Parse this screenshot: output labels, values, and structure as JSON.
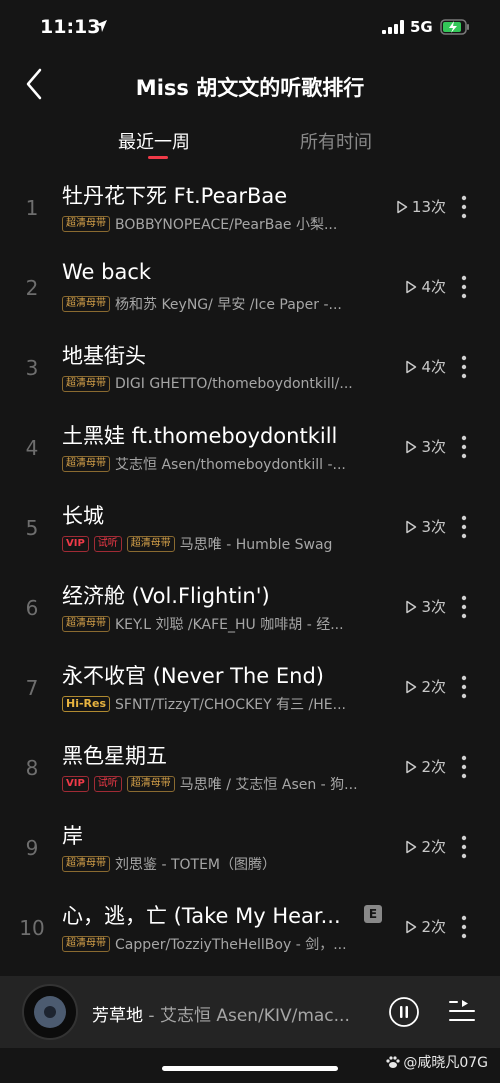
{
  "status": {
    "time": "11:13",
    "network": "5G"
  },
  "header": {
    "title": "Miss 胡文文的听歌排行"
  },
  "tabs": [
    {
      "label": "最近一周",
      "active": true
    },
    {
      "label": "所有时间",
      "active": false
    }
  ],
  "songs": [
    {
      "rank": "1",
      "title": "牡丹花下死 Ft.PearBae",
      "tags": [
        "超清母带"
      ],
      "artist": "BOBBYNOPEACE/PearBae 小梨...",
      "plays": "13次"
    },
    {
      "rank": "2",
      "title": "We back",
      "tags": [
        "超清母带"
      ],
      "artist": "杨和苏 KeyNG/ 早安 /Ice Paper -...",
      "plays": "4次"
    },
    {
      "rank": "3",
      "title": "地基街头",
      "tags": [
        "超清母带"
      ],
      "artist": "DIGI GHETTO/thomeboydontkill/...",
      "plays": "4次"
    },
    {
      "rank": "4",
      "title": "土黑娃 ft.thomeboydontkill",
      "tags": [
        "超清母带"
      ],
      "artist": "艾志恒 Asen/thomeboydontkill -...",
      "plays": "3次"
    },
    {
      "rank": "5",
      "title": "长城",
      "tags": [
        "VIP",
        "试听",
        "超清母带"
      ],
      "artist": "马思唯 - Humble Swag",
      "plays": "3次"
    },
    {
      "rank": "6",
      "title": "经济舱 (Vol.Flightin')",
      "tags": [
        "超清母带"
      ],
      "artist": "KEY.L 刘聪 /KAFE_HU 咖啡胡 - 经...",
      "plays": "3次"
    },
    {
      "rank": "7",
      "title": "永不收官 (Never The End)",
      "tags": [
        "Hi-Res"
      ],
      "artist": "SFNT/TizzyT/CHOCKEY 有三 /HE...",
      "plays": "2次"
    },
    {
      "rank": "8",
      "title": "黑色星期五",
      "tags": [
        "VIP",
        "试听",
        "超清母带"
      ],
      "artist": "马思唯 / 艾志恒 Asen - 狗...",
      "plays": "2次"
    },
    {
      "rank": "9",
      "title": "岸",
      "tags": [
        "超清母带"
      ],
      "artist": "刘思鉴 - TOTEM（图腾）",
      "plays": "2次"
    },
    {
      "rank": "10",
      "title": "心，逃，亡 (Take My Hear...",
      "badge": "E",
      "tags": [
        "超清母带"
      ],
      "artist": "Capper/TozziyTheHellBoy - 剑，...",
      "plays": "2次"
    }
  ],
  "player": {
    "title": "芳草地",
    "separator": " - ",
    "artist": "艾志恒 Asen/KIV/mac..."
  },
  "watermark": "@咸晓凡07G",
  "colors": {
    "accent": "#f03a48",
    "background": "#151515",
    "player_bg": "#242424",
    "tag_gold": "#d6a24a"
  }
}
